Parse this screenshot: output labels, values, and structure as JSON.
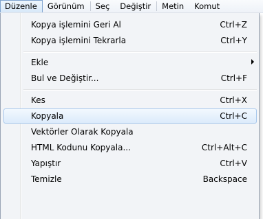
{
  "menubar": {
    "items": [
      {
        "label": "Düzenle"
      },
      {
        "label": "Görünüm"
      },
      {
        "label": "Seç"
      },
      {
        "label": "Değiştir"
      },
      {
        "label": "Metin"
      },
      {
        "label": "Komut"
      }
    ]
  },
  "edit_menu": {
    "undo": {
      "label": "Kopya işlemini Geri Al",
      "shortcut": "Ctrl+Z"
    },
    "redo": {
      "label": "Kopya işlemini Tekrarla",
      "shortcut": "Ctrl+Y"
    },
    "insert": {
      "label": "Ekle",
      "has_submenu": true
    },
    "find_replace": {
      "label": "Bul ve Değiştir...",
      "shortcut": "Ctrl+F"
    },
    "cut": {
      "label": "Kes",
      "shortcut": "Ctrl+X"
    },
    "copy": {
      "label": "Kopyala",
      "shortcut": "Ctrl+C",
      "state": "highlighted"
    },
    "copy_as_vectors": {
      "label": "Vektörler Olarak Kopyala"
    },
    "copy_html": {
      "label": "HTML Kodunu Kopyala...",
      "shortcut": "Ctrl+Alt+C"
    },
    "paste": {
      "label": "Yapıştır",
      "shortcut": "Ctrl+V"
    },
    "clear": {
      "label": "Temizle",
      "shortcut": "Backspace"
    }
  },
  "colors": {
    "menu_background": "#f2f4f7",
    "highlight_border": "#a8c8ec",
    "active_menubar_border": "#7da2ce"
  }
}
